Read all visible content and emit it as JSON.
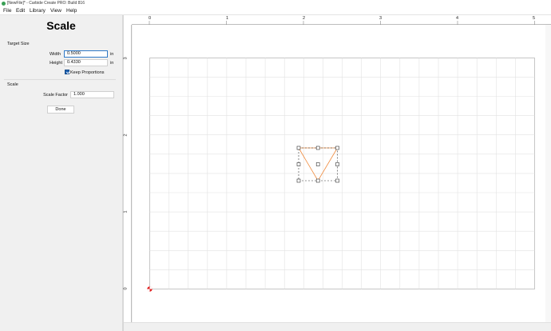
{
  "window": {
    "title": "[NewFile]* - Carbide Create PRO: Build 816"
  },
  "menu": [
    "File",
    "Edit",
    "Library",
    "View",
    "Help"
  ],
  "panel": {
    "heading": "Scale",
    "target_size_label": "Target Size",
    "width_label": "Width",
    "width_value": "0.5000",
    "width_unit": "in",
    "height_label": "Height",
    "height_value": "0.4330",
    "height_unit": "in",
    "keep_proportions_label": "Keep Proportions",
    "keep_proportions_checked": true,
    "scale_section_label": "Scale",
    "scale_factor_label": "Scale Factor",
    "scale_factor_value": "1.000",
    "done_label": "Done"
  },
  "rulers": {
    "horizontal_labels": [
      "0",
      "1",
      "2",
      "3",
      "4",
      "5"
    ],
    "vertical_labels": [
      "0",
      "1",
      "2",
      "3"
    ]
  },
  "colors": {
    "shape_stroke": "#f08a3c",
    "grid_line": "#e2e2e2",
    "origin_marker": "#e02020",
    "accent": "#1f63b3"
  }
}
